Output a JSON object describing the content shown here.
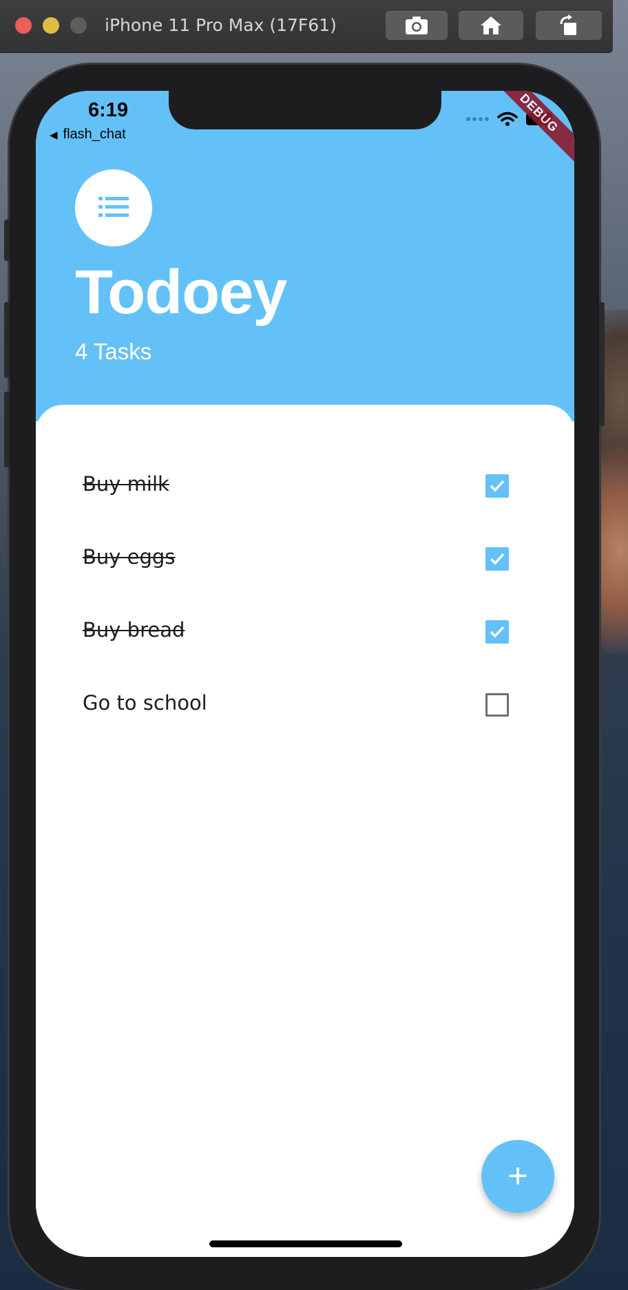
{
  "simulator": {
    "title": "iPhone 11 Pro Max (17F61)",
    "buttons": [
      "screenshot-icon",
      "home-icon",
      "rotate-icon"
    ]
  },
  "status_bar": {
    "time": "6:19",
    "back_app": "flash_chat",
    "debug_banner": "DEBUG"
  },
  "header": {
    "icon": "list-icon",
    "title": "Todoey",
    "task_count": "4 Tasks"
  },
  "tasks": [
    {
      "label": "Buy milk",
      "done": true
    },
    {
      "label": "Buy eggs",
      "done": true
    },
    {
      "label": "Buy bread",
      "done": true
    },
    {
      "label": "Go to school",
      "done": false
    }
  ],
  "fab": {
    "label": "+"
  },
  "colors": {
    "accent": "#64c1f8",
    "text": "#1c1c1c",
    "unchecked_border": "#6f6f6f"
  }
}
